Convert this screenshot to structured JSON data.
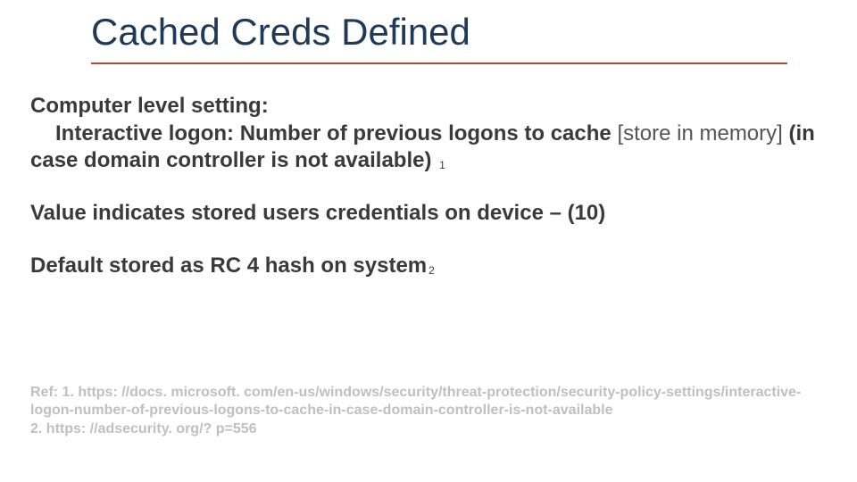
{
  "title": "Cached Creds Defined",
  "p1": {
    "line1_bold": "Computer level setting:",
    "line2_indent_bold": "Interactive logon: Number of previous logons to cache ",
    "line2_tail_light": "[store in memory] ",
    "line3_bold": "(in case domain controller is not available) ",
    "sub1": "1"
  },
  "p2": "Value indicates stored users credentials on device – (10)",
  "p3": {
    "text": "Default stored as RC 4 hash on system",
    "sub": "2"
  },
  "refs": {
    "prefix": "Ref: 1. ",
    "url1": "https: //docs. microsoft. com/en-us/windows/security/threat-protection/security-policy-settings/interactive-logon-number-of-previous-logons-to-cache-in-case-domain-controller-is-not-available",
    "line2_prefix": "2. ",
    "url2": "https: //adsecurity. org/? p=556"
  }
}
